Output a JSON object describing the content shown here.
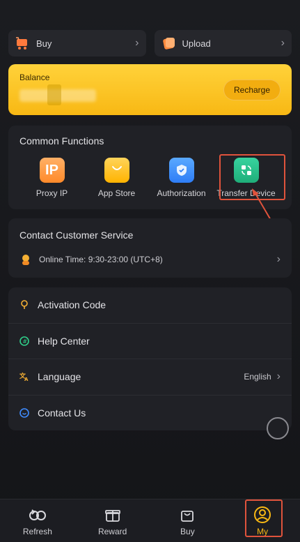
{
  "top_actions": {
    "buy_label": "Buy",
    "upload_label": "Upload"
  },
  "balance": {
    "title": "Balance",
    "recharge_label": "Recharge"
  },
  "common_functions": {
    "title": "Common Functions",
    "items": [
      {
        "label": "Proxy IP",
        "icon": "proxy-ip-icon",
        "glyph": "IP"
      },
      {
        "label": "App Store",
        "icon": "app-store-icon"
      },
      {
        "label": "Authorization",
        "icon": "authorization-icon"
      },
      {
        "label": "Transfer Device",
        "icon": "transfer-device-icon"
      }
    ]
  },
  "customer_service": {
    "title": "Contact Customer Service",
    "online_time": "Online Time: 9:30-23:00 (UTC+8)"
  },
  "menu": {
    "items": [
      {
        "label": "Activation Code",
        "icon": "key-icon"
      },
      {
        "label": "Help Center",
        "icon": "help-icon"
      },
      {
        "label": "Language",
        "icon": "translate-icon",
        "value": "English"
      },
      {
        "label": "Contact Us",
        "icon": "chat-icon"
      }
    ]
  },
  "tabbar": {
    "items": [
      {
        "label": "Refresh",
        "icon": "refresh-icon"
      },
      {
        "label": "Reward",
        "icon": "gift-icon"
      },
      {
        "label": "Buy",
        "icon": "bag-icon"
      },
      {
        "label": "My",
        "icon": "user-icon",
        "active": true
      }
    ]
  },
  "colors": {
    "accent": "#f8b814",
    "highlight": "#e0533c",
    "background": "#17181c"
  }
}
